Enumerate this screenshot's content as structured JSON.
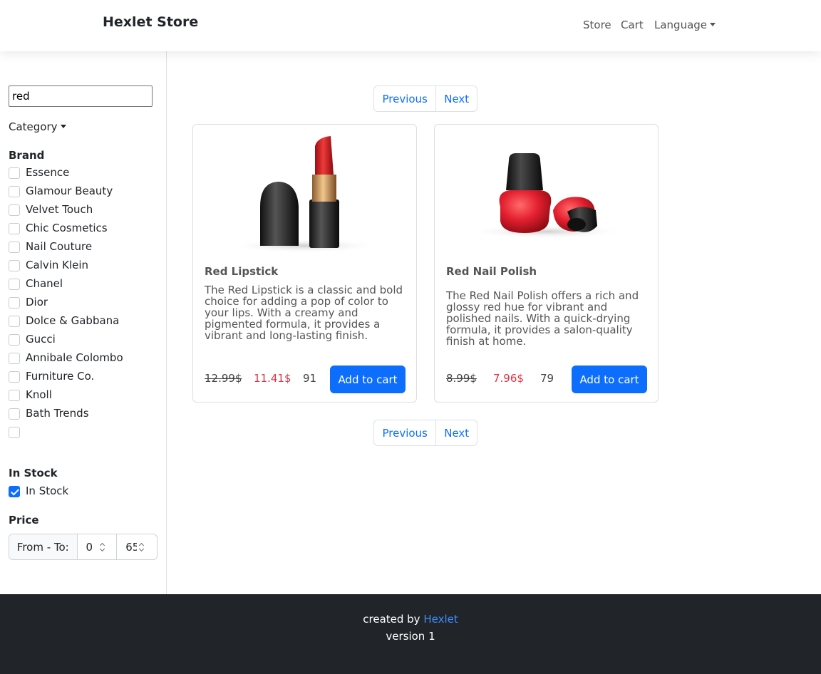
{
  "header": {
    "brand": "Hexlet Store",
    "nav": {
      "store": "Store",
      "cart": "Cart",
      "language": "Language"
    }
  },
  "sidebar": {
    "search_value": "red",
    "category_label": "Category",
    "brand_title": "Brand",
    "brands": [
      {
        "label": "Essence",
        "checked": false
      },
      {
        "label": "Glamour Beauty",
        "checked": false
      },
      {
        "label": "Velvet Touch",
        "checked": false
      },
      {
        "label": "Chic Cosmetics",
        "checked": false
      },
      {
        "label": "Nail Couture",
        "checked": false
      },
      {
        "label": "Calvin Klein",
        "checked": false
      },
      {
        "label": "Chanel",
        "checked": false
      },
      {
        "label": "Dior",
        "checked": false
      },
      {
        "label": "Dolce & Gabbana",
        "checked": false
      },
      {
        "label": "Gucci",
        "checked": false
      },
      {
        "label": "Annibale Colombo",
        "checked": false
      },
      {
        "label": "Furniture Co.",
        "checked": false
      },
      {
        "label": "Knoll",
        "checked": false
      },
      {
        "label": "Bath Trends",
        "checked": false
      },
      {
        "label": "",
        "checked": false
      }
    ],
    "stock_title": "In Stock",
    "stock_label": "In Stock",
    "stock_checked": true,
    "price_title": "Price",
    "price_label": "From - To:",
    "price_from": "0",
    "price_to": "65"
  },
  "pagination": {
    "previous": "Previous",
    "next": "Next"
  },
  "products": [
    {
      "title": "Red Lipstick",
      "description": "The Red Lipstick is a classic and bold choice for adding a pop of color to your lips. With a creamy and pigmented formula, it provides a vibrant and long-lasting finish.",
      "old_price": "12.99$",
      "new_price": "11.41$",
      "stock": "91",
      "button": "Add to cart",
      "image_icon": "lipstick-icon"
    },
    {
      "title": "Red Nail Polish",
      "description": "The Red Nail Polish offers a rich and glossy red hue for vibrant and polished nails. With a quick-drying formula, it provides a salon-quality finish at home.",
      "old_price": "8.99$",
      "new_price": "7.96$",
      "stock": "79",
      "button": "Add to cart",
      "image_icon": "nail-polish-icon"
    }
  ],
  "footer": {
    "created_by": "created by ",
    "link": "Hexlet",
    "version": "version 1"
  },
  "colors": {
    "primary": "#0d6efd",
    "sale": "#dc3545",
    "footer_bg": "#212529"
  }
}
